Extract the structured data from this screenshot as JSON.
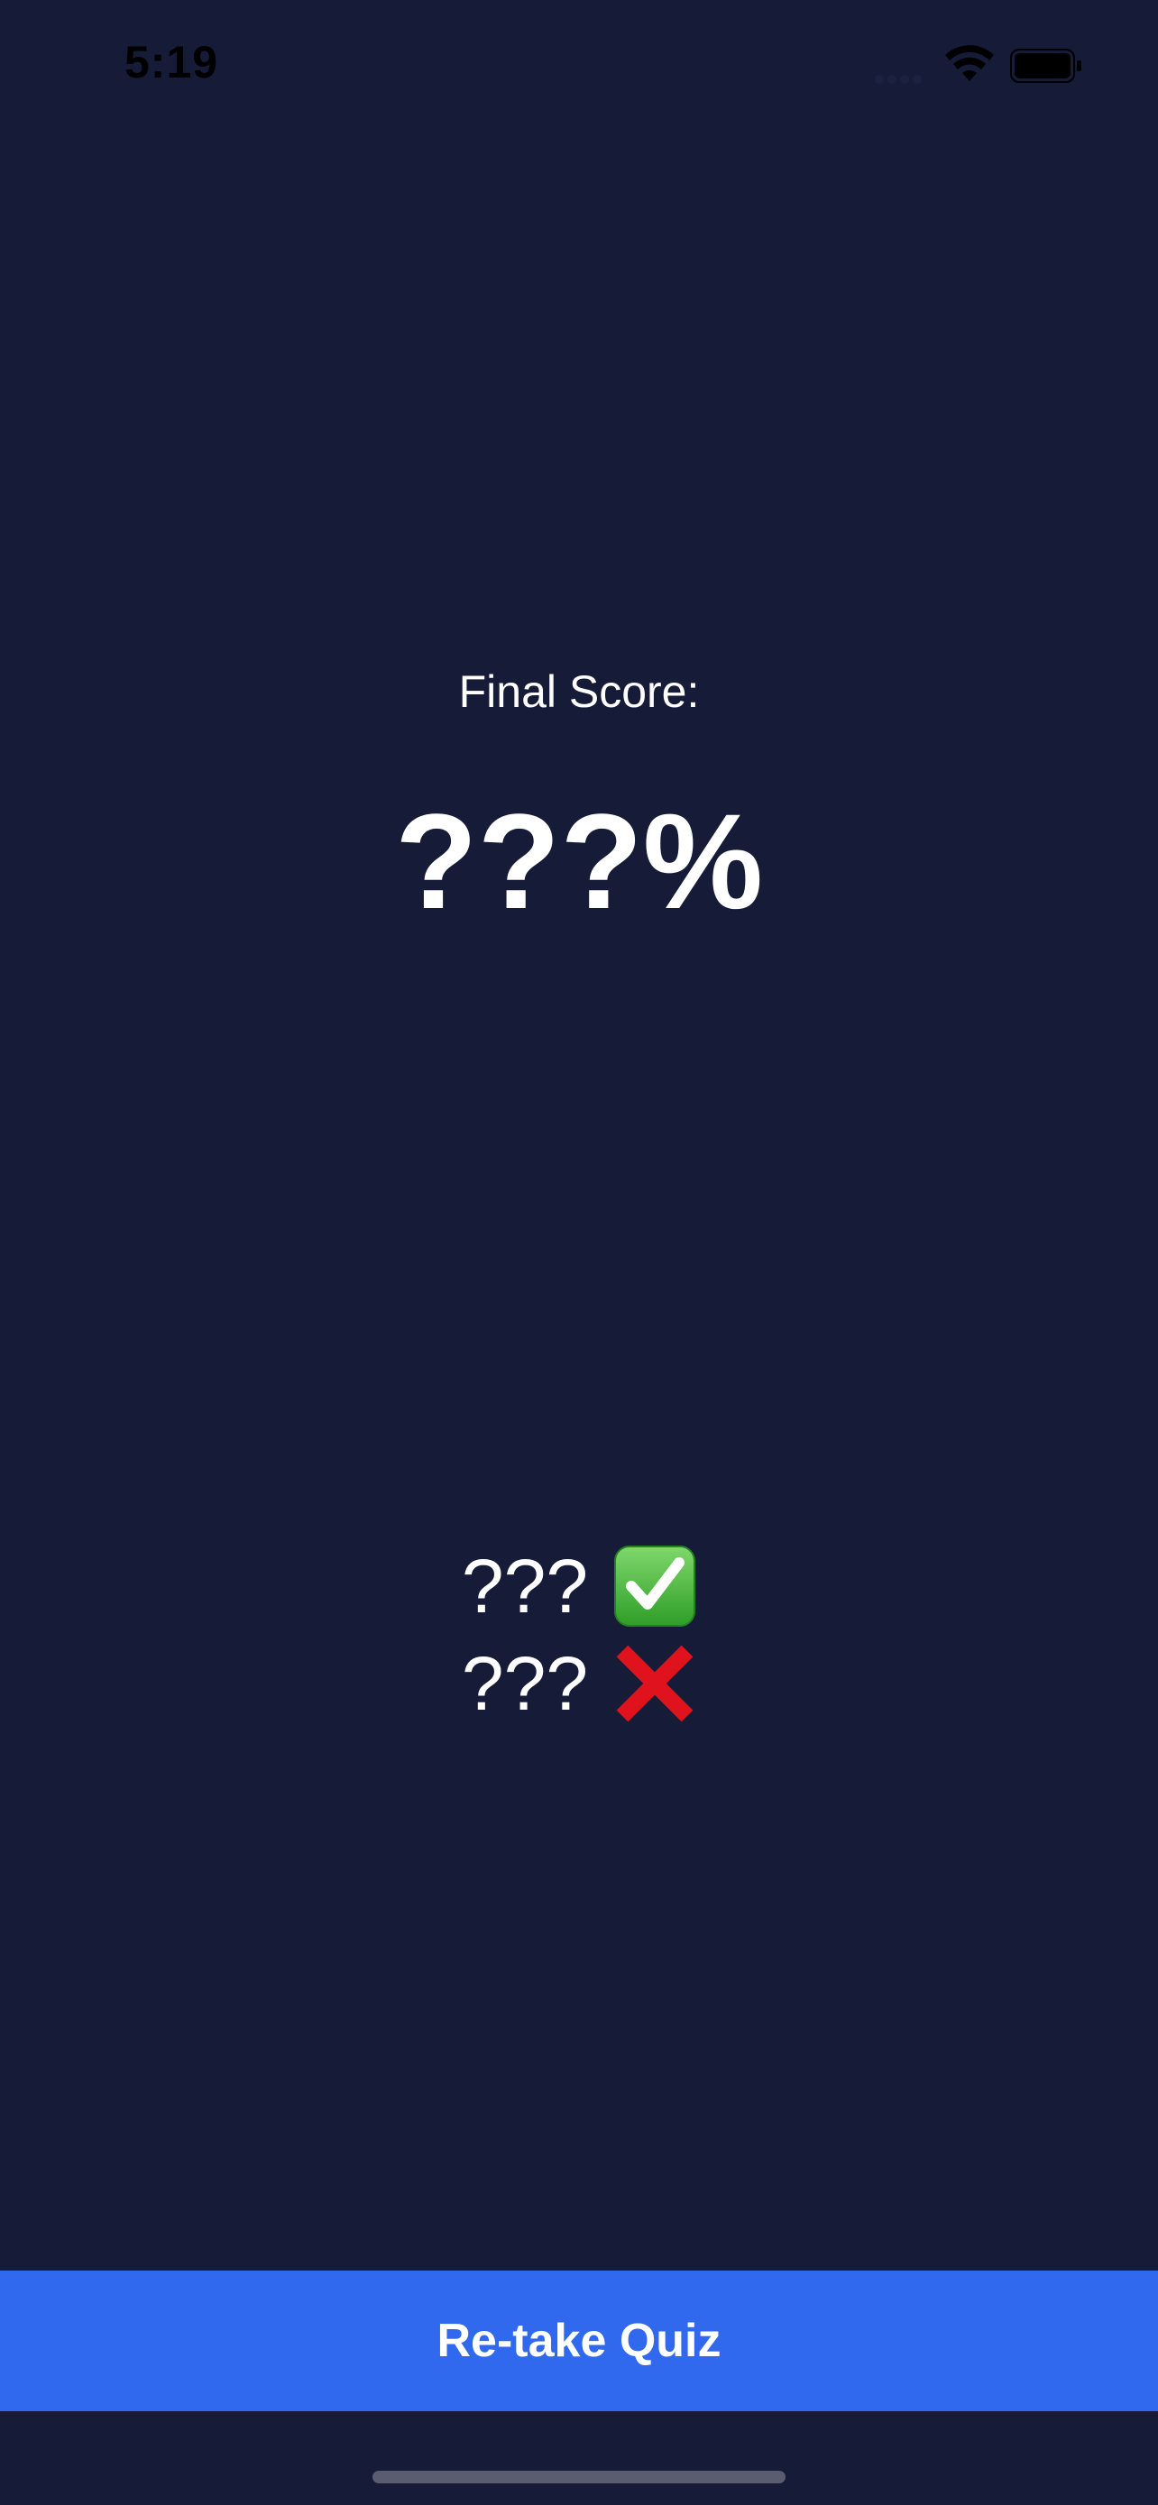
{
  "status_bar": {
    "time": "5:19"
  },
  "score": {
    "label": "Final Score:",
    "value": "???%"
  },
  "tally": {
    "correct_count": "???",
    "correct_icon": "check-mark-icon",
    "incorrect_count": "???",
    "incorrect_icon": "cross-mark-icon"
  },
  "actions": {
    "retake_label": "Re-take Quiz"
  },
  "colors": {
    "background": "#161b38",
    "button": "#3068ee",
    "check_green": "#45b637",
    "cross_red": "#e0121e"
  }
}
